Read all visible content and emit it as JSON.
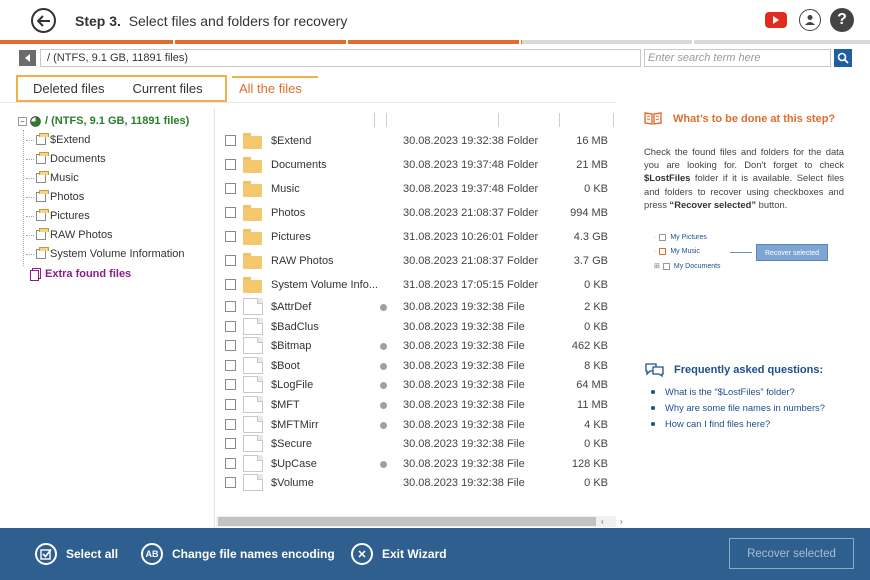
{
  "header": {
    "step_label": "Step 3.",
    "title": "Select files and folders for recovery",
    "icons": [
      "back-icon",
      "youtube-icon",
      "user-icon",
      "help-icon"
    ],
    "help_symbol": "?"
  },
  "progress": {
    "fraction": 0.6,
    "accent": "#e06d2e"
  },
  "pathbar": {
    "path": "/ (NTFS, 9.1 GB, 11891 files)",
    "search_placeholder": "Enter search term here"
  },
  "tabs": {
    "deleted": "Deleted files",
    "current": "Current files",
    "all": "All the files"
  },
  "tree": {
    "root": "/ (NTFS, 9.1 GB, 11891 files)",
    "items": [
      "$Extend",
      "Documents",
      "Music",
      "Photos",
      "Pictures",
      "RAW Photos",
      "System Volume Information"
    ],
    "extra": "Extra found files",
    "toggle_expanded": "−",
    "toggle_collapsed": "+"
  },
  "files": [
    {
      "name": "$Extend",
      "kind": "folder",
      "dot": false,
      "date": "30.08.2023 19:32:38",
      "type": "Folder",
      "size": "16 MB"
    },
    {
      "name": "Documents",
      "kind": "folder",
      "dot": false,
      "date": "30.08.2023 19:37:48",
      "type": "Folder",
      "size": "21 MB"
    },
    {
      "name": "Music",
      "kind": "folder",
      "dot": false,
      "date": "30.08.2023 19:37:48",
      "type": "Folder",
      "size": "0 KB"
    },
    {
      "name": "Photos",
      "kind": "folder",
      "dot": false,
      "date": "30.08.2023 21:08:37",
      "type": "Folder",
      "size": "994 MB"
    },
    {
      "name": "Pictures",
      "kind": "folder",
      "dot": false,
      "date": "31.08.2023 10:26:01",
      "type": "Folder",
      "size": "4.3 GB"
    },
    {
      "name": "RAW Photos",
      "kind": "folder",
      "dot": false,
      "date": "30.08.2023 21:08:37",
      "type": "Folder",
      "size": "3.7 GB"
    },
    {
      "name": "System Volume Info...",
      "kind": "folder",
      "dot": false,
      "date": "31.08.2023 17:05:15",
      "type": "Folder",
      "size": "0 KB"
    },
    {
      "name": "$AttrDef",
      "kind": "file",
      "dot": true,
      "date": "30.08.2023 19:32:38",
      "type": "File",
      "size": "2 KB"
    },
    {
      "name": "$BadClus",
      "kind": "file",
      "dot": false,
      "date": "30.08.2023 19:32:38",
      "type": "File",
      "size": "0 KB"
    },
    {
      "name": "$Bitmap",
      "kind": "file",
      "dot": true,
      "date": "30.08.2023 19:32:38",
      "type": "File",
      "size": "462 KB"
    },
    {
      "name": "$Boot",
      "kind": "file",
      "dot": true,
      "date": "30.08.2023 19:32:38",
      "type": "File",
      "size": "8 KB"
    },
    {
      "name": "$LogFile",
      "kind": "file",
      "dot": true,
      "date": "30.08.2023 19:32:38",
      "type": "File",
      "size": "64 MB"
    },
    {
      "name": "$MFT",
      "kind": "file",
      "dot": true,
      "date": "30.08.2023 19:32:38",
      "type": "File",
      "size": "11 MB"
    },
    {
      "name": "$MFTMirr",
      "kind": "file",
      "dot": true,
      "date": "30.08.2023 19:32:38",
      "type": "File",
      "size": "4 KB"
    },
    {
      "name": "$Secure",
      "kind": "file",
      "dot": false,
      "date": "30.08.2023 19:32:38",
      "type": "File",
      "size": "0 KB"
    },
    {
      "name": "$UpCase",
      "kind": "file",
      "dot": true,
      "date": "30.08.2023 19:32:38",
      "type": "File",
      "size": "128 KB"
    },
    {
      "name": "$Volume",
      "kind": "file",
      "dot": false,
      "date": "30.08.2023 19:32:38",
      "type": "File",
      "size": "0 KB"
    }
  ],
  "scrollbar": {
    "left_arrow": "‹",
    "right_arrow": "›"
  },
  "info": {
    "title": "What’s to be done at this step?",
    "text_1": "Check the found files and folders for the data you are looking for. Don’t forget to check ",
    "lostfiles": "$LostFiles",
    "text_2": " folder if it is available. Select files and folders to recover using checkboxes and press ",
    "recover_quote": "“Recover selected”",
    "text_3": " button.",
    "demo": {
      "item_1": "My Pictures",
      "item_2": "My Music",
      "item_3": "My Documents",
      "button": "Recover selected"
    },
    "faq_title": "Frequently asked questions:",
    "faq": [
      "What is the “$LostFiles” folder?",
      "Why are some file names in numbers?",
      "How can I find files here?"
    ]
  },
  "footer": {
    "select_all": "Select all",
    "change_encoding": "Change file names encoding",
    "encoding_glyph": "AB",
    "exit": "Exit Wizard",
    "exit_glyph": "✕",
    "recover": "Recover selected",
    "colors": {
      "bar": "#2e5f8e"
    }
  }
}
